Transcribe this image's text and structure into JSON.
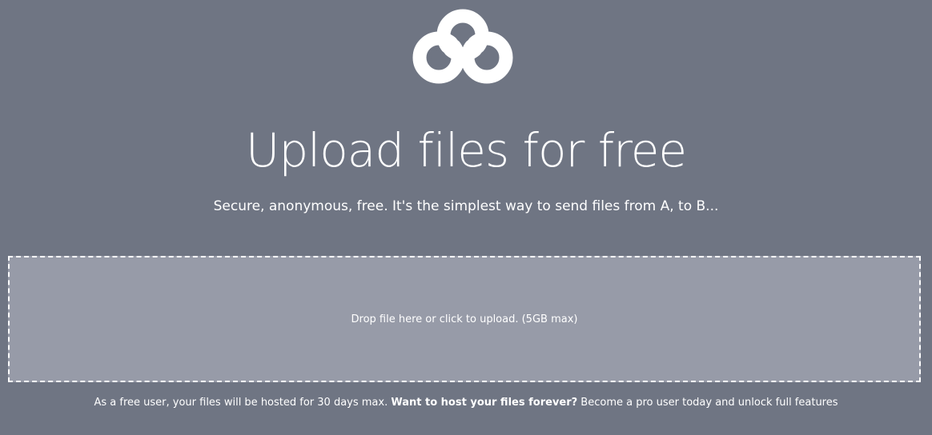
{
  "logo": {
    "icon": "cloud-infinity-logo-icon",
    "color": "#ffffff"
  },
  "hero": {
    "title": "Upload files for free",
    "subtitle": "Secure, anonymous, free. It's the simplest way to send files from A, to B..."
  },
  "dropzone": {
    "label": "Drop file here or click to upload. (5GB max)",
    "background": "#979ba8",
    "border_color": "#ffffff"
  },
  "footer": {
    "prefix": "As a free user, your files will be hosted for 30 days max. ",
    "cta": "Want to host your files forever?",
    "suffix": " Become a pro user today and unlock full features"
  },
  "colors": {
    "page_background": "#6f7583",
    "text": "#ffffff"
  }
}
